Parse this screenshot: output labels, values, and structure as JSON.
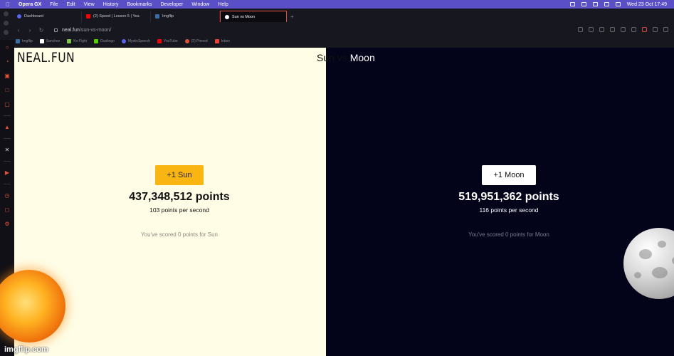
{
  "menubar": {
    "app": "Opera GX",
    "items": [
      "File",
      "Edit",
      "View",
      "History",
      "Bookmarks",
      "Developer",
      "Window",
      "Help"
    ],
    "datetime": "Wed 23 Oct  17:49"
  },
  "tabs": [
    {
      "label": "Dashboard",
      "color": "#5865f2"
    },
    {
      "label": "(2) Speed | Lesson 5 | Yea",
      "color": "#ff0000"
    },
    {
      "label": "Imgflip",
      "color": "#3a6ea5"
    },
    {
      "label": "Sun vs Moon",
      "color": "#ffffff",
      "active": true
    }
  ],
  "address": {
    "domain": "neal.fun",
    "path": "/sun-vs-moon/"
  },
  "bookmarks": [
    {
      "label": "Imgflip",
      "color": "#3a6ea5"
    },
    {
      "label": "Sanchez",
      "color": "#ffffff"
    },
    {
      "label": "Ko-Fight",
      "color": "#7cc44b"
    },
    {
      "label": "Duolingo",
      "color": "#58cc02"
    },
    {
      "label": "MysticSpeech",
      "color": "#5865f2"
    },
    {
      "label": "YouTube",
      "color": "#ff0000"
    },
    {
      "label": "(2) Pinned",
      "color": "#e0523a"
    },
    {
      "label": "Inbox",
      "color": "#ea4335"
    }
  ],
  "page": {
    "logo": "NEAL.FUN",
    "title_sun_part": "Sun",
    "title_mid": " vs ",
    "title_moon_part": "Moon",
    "sun": {
      "button": "+1 Sun",
      "points": "437,348,512 points",
      "rate": "103 points per second",
      "scored": "You've scored 0 points for Sun"
    },
    "moon": {
      "button": "+1 Moon",
      "points": "519,951,362 points",
      "rate": "116 points per second",
      "scored": "You've scored 0 points for Moon"
    }
  },
  "watermark": "imgflip.com",
  "colors": {
    "sun_bg": "#fffde6",
    "moon_bg": "#03031a",
    "sun_button": "#f9b512",
    "moon_button": "#ffffff",
    "accent": "#e0523a"
  }
}
